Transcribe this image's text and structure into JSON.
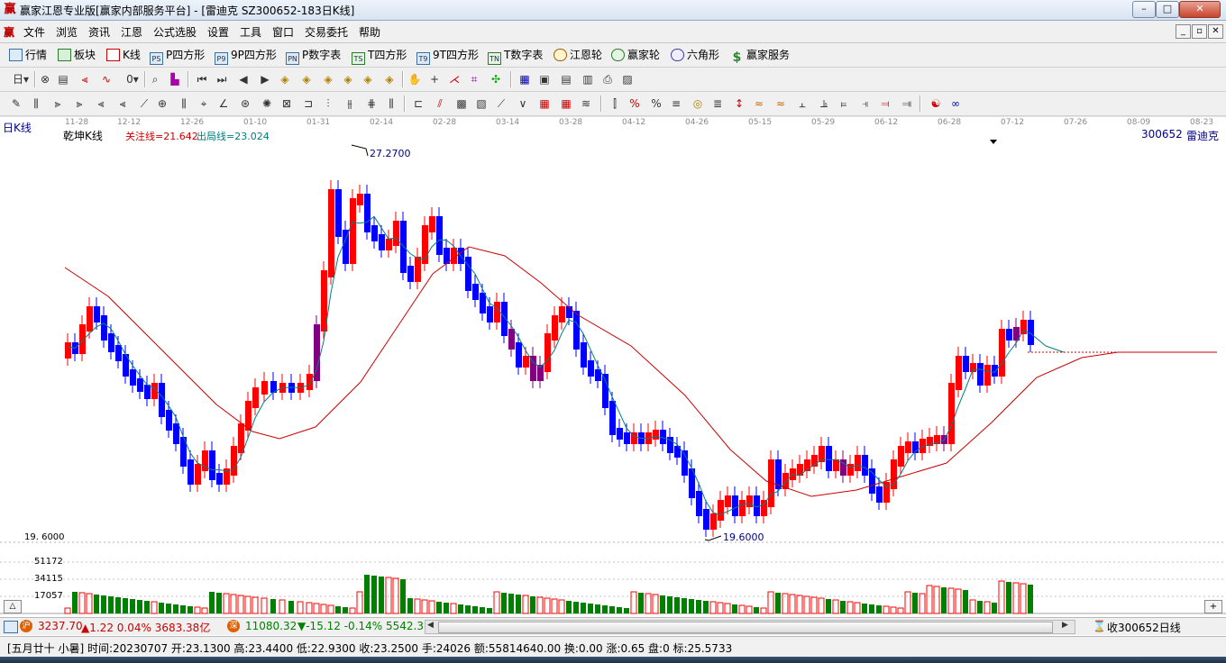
{
  "window": {
    "title": "赢家江恩专业版[赢家内部服务平台] - [雷迪克  SZ300652-183日K线]",
    "app_icon": "赢",
    "minimize": "–",
    "maximize": "□",
    "close": "✕"
  },
  "menubar": {
    "logo": "赢",
    "items": [
      "文件",
      "浏览",
      "资讯",
      "江恩",
      "公式选股",
      "设置",
      "工具",
      "窗口",
      "交易委托",
      "帮助"
    ],
    "mdi_buttons": [
      "_",
      "▫",
      "✕"
    ]
  },
  "toolbar1": {
    "items": [
      {
        "label": "行情",
        "icon": "grid-icon"
      },
      {
        "label": "板块",
        "icon": "blocks-icon"
      },
      {
        "label": "K线",
        "icon": "kline-icon"
      },
      {
        "label": "P四方形",
        "icon": "PS"
      },
      {
        "label": "9P四方形",
        "icon": "P9"
      },
      {
        "label": "P数字表",
        "icon": "PN"
      },
      {
        "label": "T四方形",
        "icon": "TS"
      },
      {
        "label": "9T四方形",
        "icon": "T9"
      },
      {
        "label": "T数字表",
        "icon": "TN"
      },
      {
        "label": "江恩轮",
        "icon": "wheel-icon"
      },
      {
        "label": "赢家轮",
        "icon": "wheel2-icon"
      },
      {
        "label": "六角形",
        "icon": "hexagon-icon"
      },
      {
        "label": "赢家服务",
        "icon": "dollar-icon"
      }
    ]
  },
  "chart": {
    "period_label": "日K线",
    "indicator_name": "乾坤K线",
    "focus_line": "关注线=21.642",
    "exit_line": "出局线=23.024",
    "stock_code": "300652",
    "stock_name": "雷迪克",
    "high_label": "27.2700",
    "low_label": "19.6000",
    "low_axis_label": "19. 6000",
    "date_ticks": [
      "11-28",
      "12-12",
      "12-26",
      "01-10",
      "01-31",
      "02-14",
      "02-28",
      "03-14",
      "03-28",
      "04-12",
      "04-26",
      "05-15",
      "05-29",
      "06-12",
      "06-28",
      "07-12",
      "07-26",
      "08-09",
      "08-23"
    ],
    "volume_ticks": [
      "51172",
      "34115",
      "17057"
    ],
    "colors": {
      "up": "#ff0000",
      "down": "#0000ff",
      "neutral": "#800080",
      "volume_up": "#ff0000",
      "volume_down": "#008000",
      "ma_short": "#008080",
      "ma_long": "#cc0000"
    }
  },
  "chart_data": {
    "type": "candlestick",
    "title": "乾坤K线",
    "ylim": [
      19.6,
      27.27
    ],
    "high": 27.27,
    "low": 19.6,
    "focus_line": 21.642,
    "exit_line": 23.024,
    "volume_ticks": [
      51172,
      34115,
      17057
    ]
  },
  "statusbar1": {
    "sh_index": "3237.70",
    "sh_change": "▲1.22 0.04% 3683.38亿",
    "sz_index": "11080.32",
    "sz_change": "▼-15.12 -0.14% 5542.3",
    "right_text": "收300652日线"
  },
  "statusbar2": {
    "text": "[五月廿十 小暑] 时间:20230707 开:23.1300 高:23.4400 低:22.9300 收:23.2500 手:24026 额:55814640.00 换:0.00 涨:0.65 盘:0 标:25.5733"
  }
}
